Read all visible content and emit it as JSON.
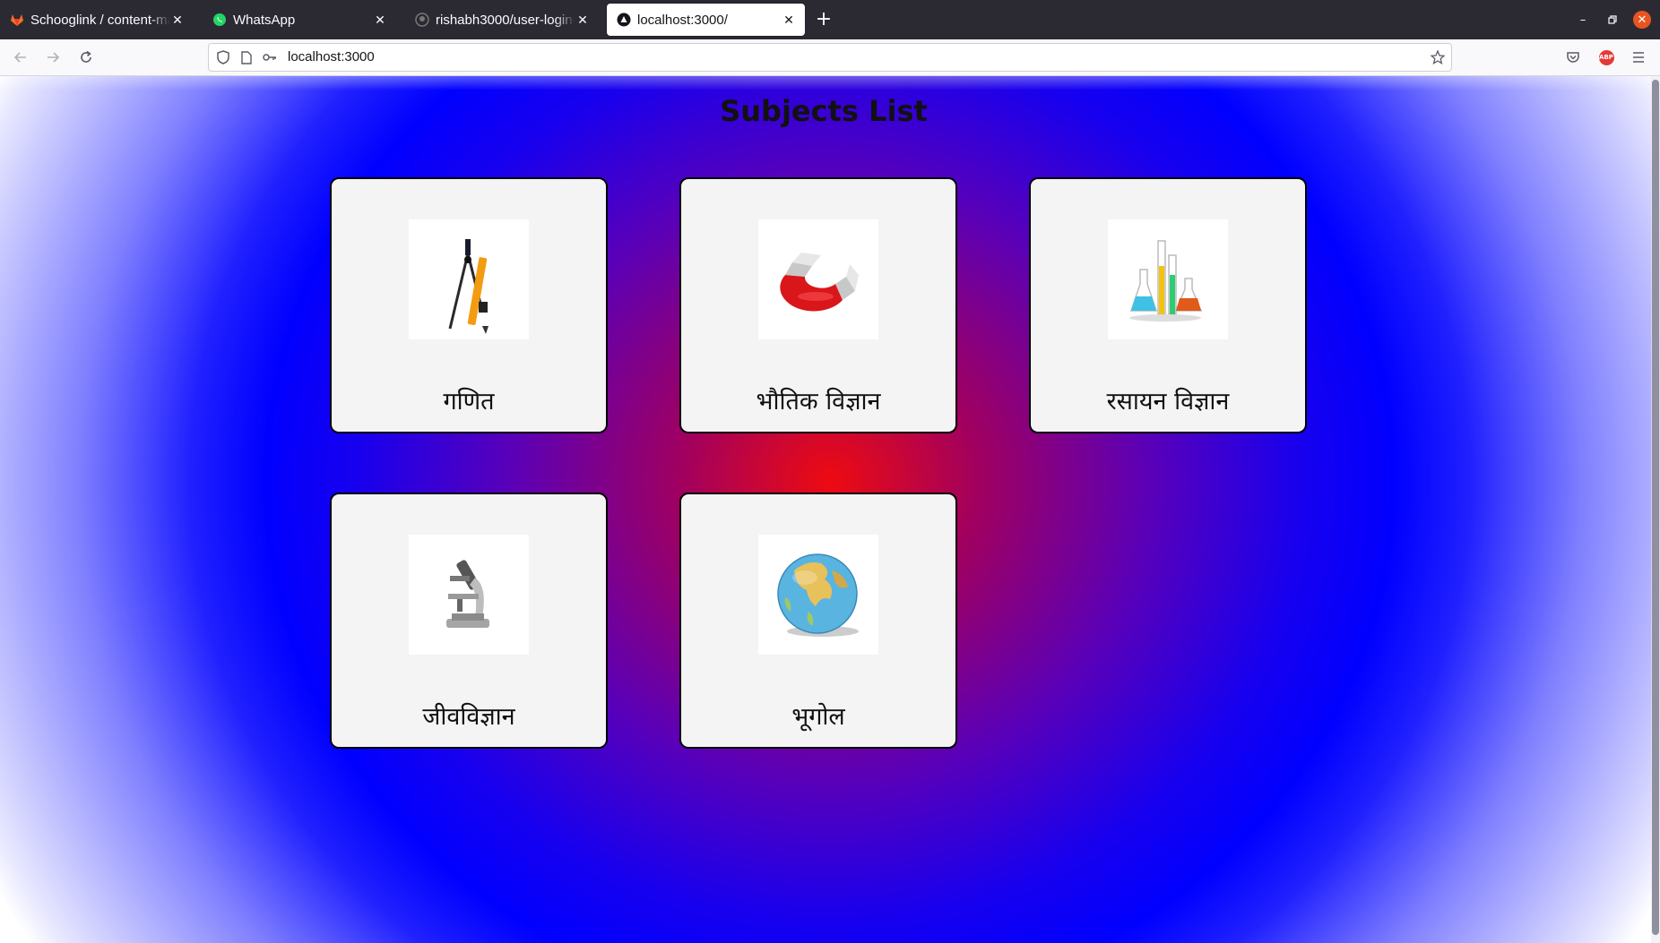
{
  "browser": {
    "tabs": [
      {
        "title": "Schooglink / content-man",
        "icon": "gitlab-icon"
      },
      {
        "title": "WhatsApp",
        "icon": "whatsapp-icon"
      },
      {
        "title": "rishabh3000/user-login-a",
        "icon": "github-icon"
      },
      {
        "title": "localhost:3000/",
        "icon": "react-icon",
        "active": true
      }
    ],
    "url": "localhost:3000"
  },
  "page": {
    "title": "Subjects List",
    "subjects": [
      {
        "label": "गणित",
        "icon": "compass-icon"
      },
      {
        "label": "भौतिक विज्ञान",
        "icon": "magnet-icon"
      },
      {
        "label": "रसायन विज्ञान",
        "icon": "chemistry-flasks-icon"
      },
      {
        "label": "जीवविज्ञान",
        "icon": "microscope-icon"
      },
      {
        "label": "भूगोल",
        "icon": "globe-icon"
      }
    ]
  },
  "colors": {
    "gradient_center": "#ee0b10",
    "gradient_mid": "#0000ff",
    "gradient_edge": "#ffffff",
    "card_bg": "#f4f4f4"
  }
}
